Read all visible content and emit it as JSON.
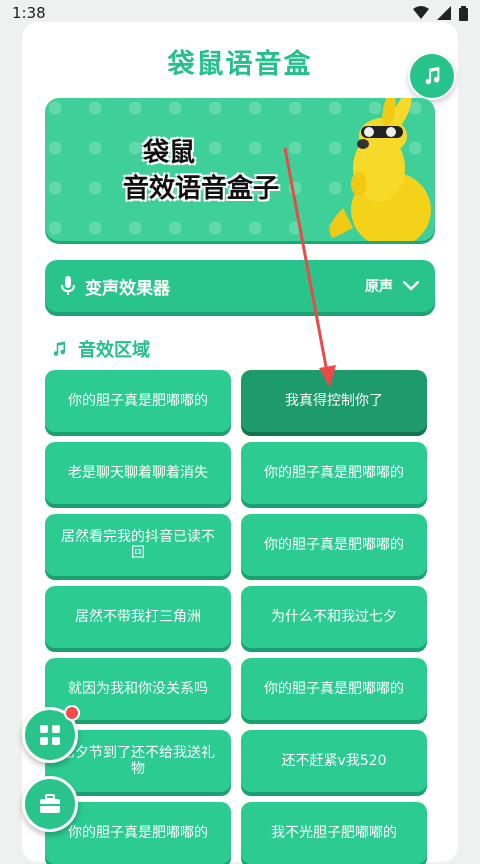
{
  "status": {
    "time": "1:38"
  },
  "app": {
    "title": "袋鼠语音盒"
  },
  "banner": {
    "line1": "袋鼠",
    "line2": "音效语音盒子"
  },
  "voice_effect": {
    "label": "变声效果器",
    "value": "原声"
  },
  "section": {
    "title": "音效区域"
  },
  "sounds": [
    {
      "label": "你的胆子真是肥嘟嘟的",
      "active": false
    },
    {
      "label": "我真得控制你了",
      "active": true
    },
    {
      "label": "老是聊天聊着聊着消失",
      "active": false
    },
    {
      "label": "你的胆子真是肥嘟嘟的",
      "active": false
    },
    {
      "label": "居然看完我的抖音已读不回",
      "active": false
    },
    {
      "label": "你的胆子真是肥嘟嘟的",
      "active": false
    },
    {
      "label": "居然不带我打三角洲",
      "active": false
    },
    {
      "label": "为什么不和我过七夕",
      "active": false
    },
    {
      "label": "就因为我和你没关系吗",
      "active": false
    },
    {
      "label": "你的胆子真是肥嘟嘟的",
      "active": false
    },
    {
      "label": "七夕节到了还不给我送礼物",
      "active": false
    },
    {
      "label": "还不赶紧v我520",
      "active": false
    },
    {
      "label": "你的胆子真是肥嘟嘟的",
      "active": false
    },
    {
      "label": "我不光胆子肥嘟嘟的",
      "active": false
    }
  ],
  "colors": {
    "primary": "#28c48c",
    "active": "#1e9b6d",
    "title": "#24c08a",
    "annotation_arrow": "#e84a4a"
  },
  "icons": {
    "music_fab": "music-note-icon",
    "mic": "microphone-icon",
    "chevron": "chevron-down-icon",
    "grid_fab": "grid-icon",
    "toolbox_fab": "toolbox-icon"
  }
}
